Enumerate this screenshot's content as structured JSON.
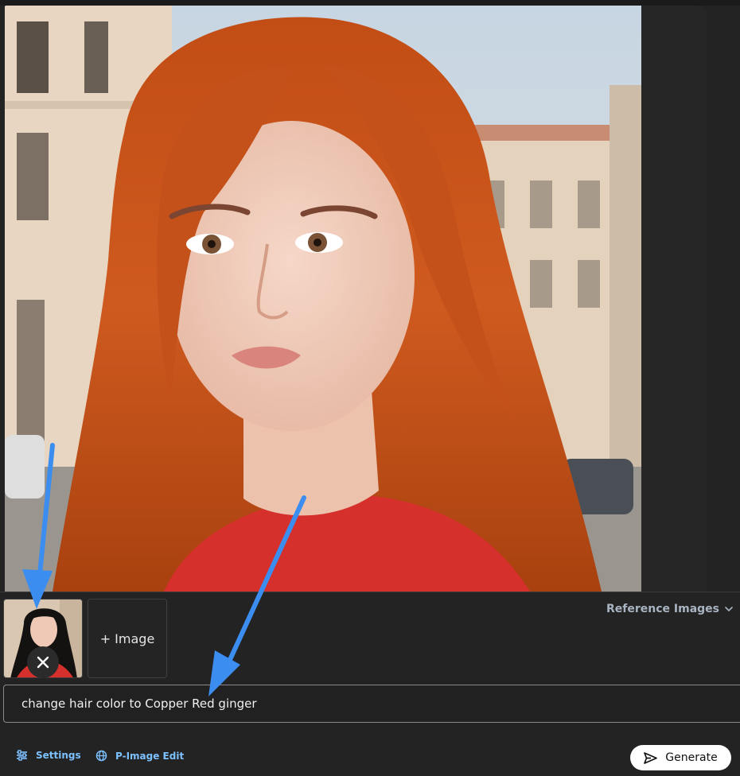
{
  "reference": {
    "toggle_label": "Reference Images",
    "add_image_label": "+ Image"
  },
  "prompt": {
    "value": "change hair color to Copper Red ginger"
  },
  "toolbar": {
    "settings_label": "Settings",
    "edit_label": "P-Image Edit",
    "generate_label": "Generate"
  },
  "icons": {
    "settings": "sliders-icon",
    "edit": "globe-icon",
    "generate": "send-icon",
    "remove": "close-icon",
    "toggle": "chevron-down-icon"
  },
  "colors": {
    "accent_link": "#7cc0ff",
    "annotation_arrow": "#3b8ef0",
    "hair_main": "#c9541c"
  }
}
